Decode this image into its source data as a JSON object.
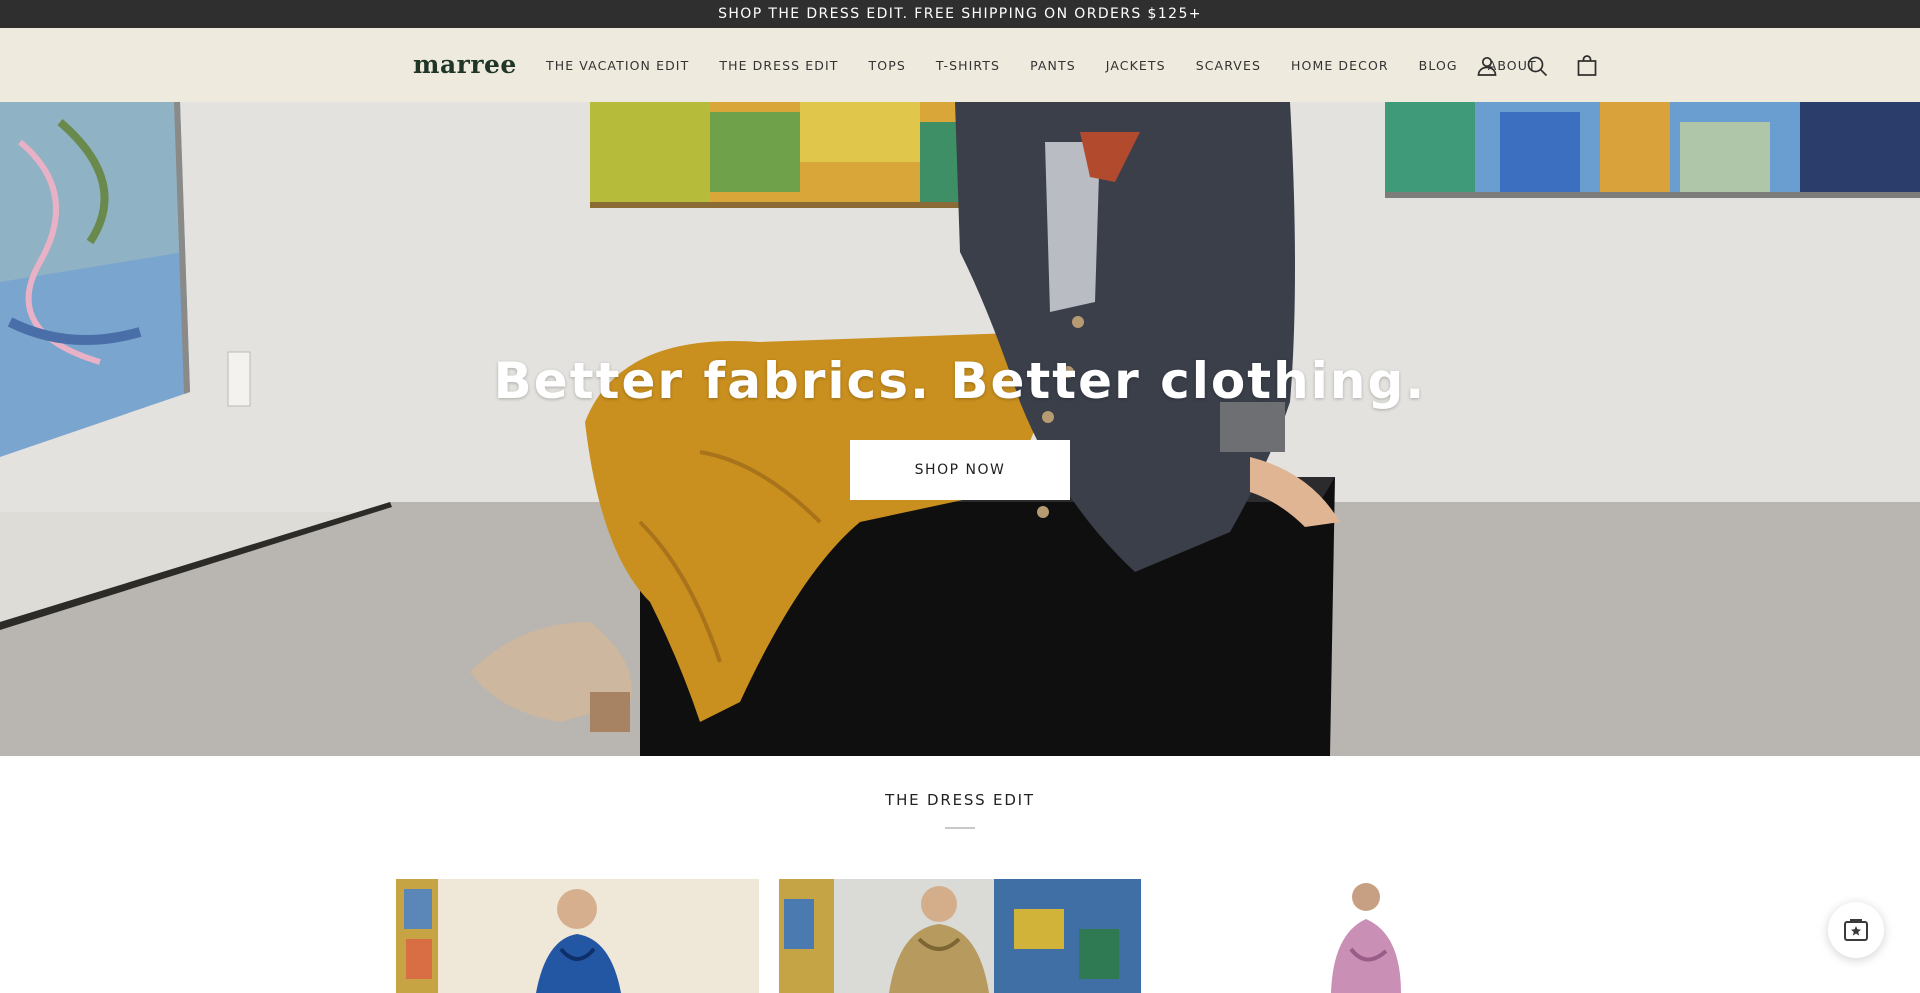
{
  "announcement": {
    "text": "SHOP THE DRESS EDIT. FREE SHIPPING ON ORDERS $125+"
  },
  "header": {
    "logo": "marree",
    "nav": [
      {
        "label": "THE VACATION EDIT"
      },
      {
        "label": "THE DRESS EDIT"
      },
      {
        "label": "TOPS"
      },
      {
        "label": "T-SHIRTS"
      },
      {
        "label": "PANTS"
      },
      {
        "label": "JACKETS"
      },
      {
        "label": "SCARVES"
      },
      {
        "label": "HOME DECOR"
      },
      {
        "label": "BLOG"
      },
      {
        "label": "ABOUT"
      }
    ],
    "icons": [
      "account-icon",
      "search-icon",
      "cart-icon"
    ]
  },
  "hero": {
    "title": "Better fabrics. Better clothing.",
    "cta_label": "SHOP NOW"
  },
  "section": {
    "title": "THE DRESS EDIT"
  },
  "chat": {
    "icon": "chat-icon"
  },
  "colors": {
    "announcement_bg": "#2f2f2f",
    "header_bg": "#efeade",
    "logo": "#1f3527",
    "mustard": "#c98f1f",
    "charcoal_jacket": "#3a3f4a"
  }
}
